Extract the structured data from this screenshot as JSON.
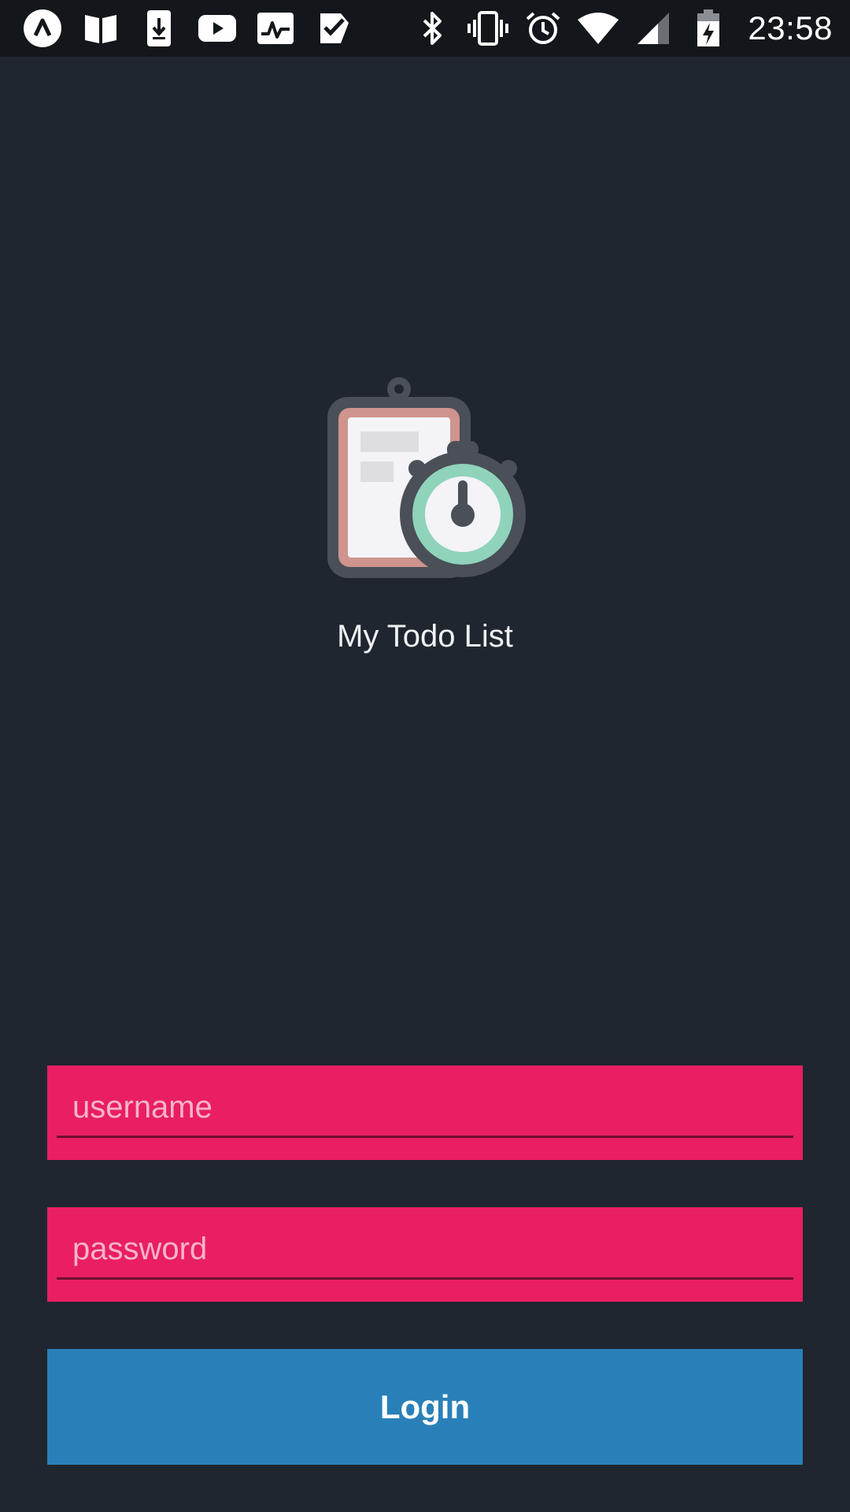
{
  "status_bar": {
    "time": "23:58",
    "left_icons": [
      "app-a-icon",
      "book-icon",
      "download-icon",
      "youtube-icon",
      "activity-icon",
      "check-icon"
    ],
    "right_icons": [
      "bluetooth-icon",
      "vibrate-icon",
      "alarm-icon",
      "wifi-icon",
      "signal-icon",
      "battery-charging-icon"
    ]
  },
  "app": {
    "title": "My Todo List",
    "logo_icon": "clipboard-stopwatch-icon"
  },
  "form": {
    "username_placeholder": "username",
    "username_value": "",
    "password_placeholder": "password",
    "password_value": "",
    "login_label": "Login"
  },
  "colors": {
    "background": "#20262f",
    "status_bar": "#13171b",
    "input_background": "#e91e63",
    "button_background": "#2980b9"
  }
}
